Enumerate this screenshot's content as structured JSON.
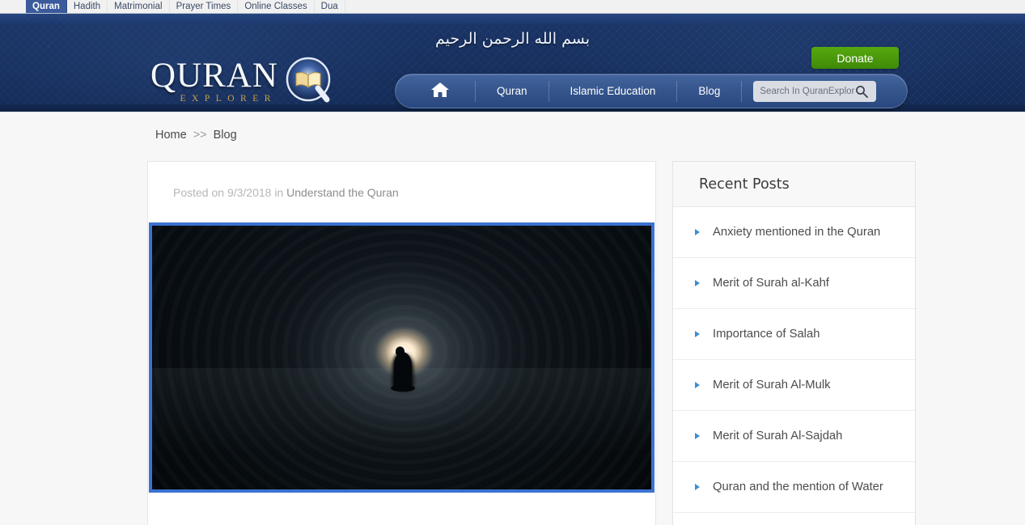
{
  "topbar": {
    "tabs": [
      {
        "label": "Quran",
        "active": true
      },
      {
        "label": "Hadith",
        "active": false
      },
      {
        "label": "Matrimonial",
        "active": false
      },
      {
        "label": "Prayer Times",
        "active": false
      },
      {
        "label": "Online Classes",
        "active": false
      },
      {
        "label": "Dua",
        "active": false
      }
    ]
  },
  "header": {
    "bismillah": "بسم الله الرحمن الرحيم",
    "logo": {
      "primary": "QURAN",
      "secondary": "EXPLORER"
    },
    "donate_label": "Donate",
    "nav": [
      {
        "label": "",
        "icon": "home-icon"
      },
      {
        "label": "Quran"
      },
      {
        "label": "Islamic Education"
      },
      {
        "label": "Blog"
      }
    ],
    "search": {
      "placeholder": "Search In QuranExplorer",
      "value": "",
      "icon": "search-icon"
    },
    "colors": {
      "header_bg": "#17305f",
      "nav_pill": "#35558c",
      "donate_green": "#4a9e0e",
      "logo_gold": "#c9a24a"
    }
  },
  "breadcrumb": {
    "home": "Home",
    "separator": ">>",
    "current": "Blog"
  },
  "post": {
    "meta_prefix": "Posted on 9/3/2018 in",
    "date": "9/3/2018",
    "category": "Understand the Quran",
    "image_alt": "Silhouette of a person praying in a dark tunnel with light at the end",
    "image_border_color": "#3b72d0"
  },
  "sidebar": {
    "title": "Recent Posts",
    "items": [
      {
        "label": "Anxiety mentioned in the Quran"
      },
      {
        "label": "Merit of Surah al-Kahf"
      },
      {
        "label": "Importance of Salah"
      },
      {
        "label": "Merit of Surah Al-Mulk"
      },
      {
        "label": "Merit of Surah Al-Sajdah"
      },
      {
        "label": "Quran and the mention of Water"
      }
    ],
    "bullet_color": "#3a8ed6"
  }
}
